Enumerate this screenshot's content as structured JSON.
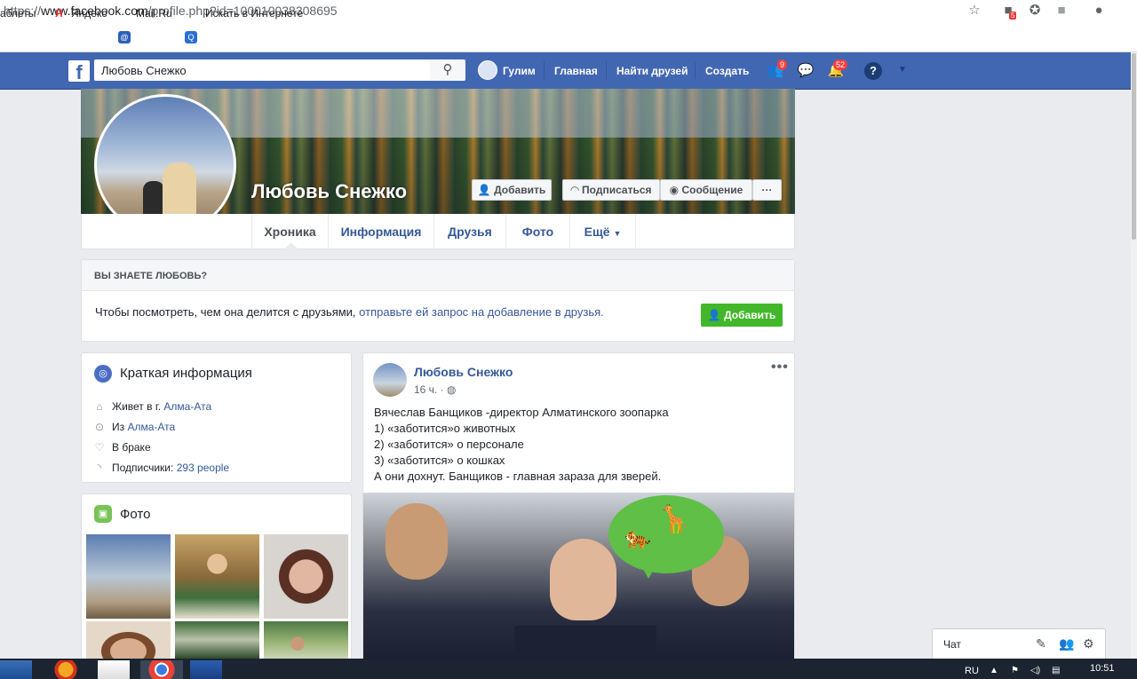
{
  "browser": {
    "url_prefix": "https://",
    "url_host": "www.facebook.com",
    "url_path": "/profile.php?id=100010038308695",
    "ext_badge": "5",
    "bookmarks": [
      "аблеты",
      "Яндекс",
      "Mail.Ru",
      "Искать в Интернете"
    ]
  },
  "fb": {
    "search_value": "Любовь Снежко",
    "user": "Гулим",
    "nav": [
      "Главная",
      "Найти друзей",
      "Создать"
    ],
    "friend_requests": "9",
    "notifications": "52",
    "logo": "f"
  },
  "profile": {
    "name": "Любовь Снежко",
    "add_friend": "Добавить",
    "follow": "Подписаться",
    "message": "Сообщение",
    "more": "···",
    "tabs": [
      "Хроника",
      "Информация",
      "Друзья",
      "Фото",
      "Ещё"
    ]
  },
  "know": {
    "title": "ВЫ ЗНАЕТЕ ЛЮБОВЬ?",
    "text": "Чтобы посмотреть, чем она делится с друзьями, ",
    "link": "отправьте ей запрос на добавление в друзья.",
    "button": "Добавить"
  },
  "intro": {
    "title": "Краткая информация",
    "lives_prefix": "Живет в г. ",
    "lives_city": "Алма-Ата",
    "from_prefix": "Из ",
    "from_city": "Алма-Ата",
    "relationship": "В браке",
    "followers_prefix": "Подписчики: ",
    "followers_count": "293 people"
  },
  "photos": {
    "title": "Фото"
  },
  "post": {
    "author": "Любовь Снежко",
    "time": "16 ч.",
    "lines": [
      "Вячеслав Банщиков -директор Алматинского зоопарка",
      "1) «заботится»о животных",
      "2) «заботится» о персонале",
      "3) «заботится» о кошках",
      "А они дохнут. Банщиков - главная зараза для зверей."
    ]
  },
  "chat": {
    "label": "Чат"
  },
  "taskbar": {
    "lang": "RU",
    "time": "10:51"
  },
  "colors": {
    "fb_blue": "#4267b2",
    "link": "#365899",
    "green": "#42b72a",
    "badge": "#fa3e3e"
  }
}
